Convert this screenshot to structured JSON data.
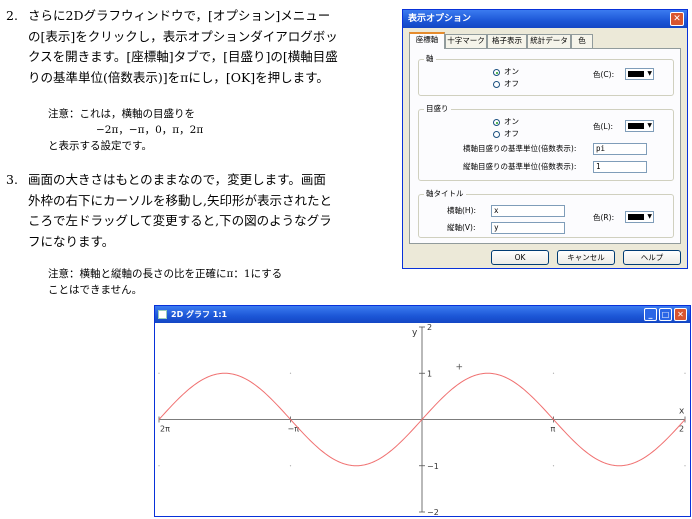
{
  "doc": {
    "item2": {
      "num": "2.",
      "lines": [
        "さらに2Dグラフウィンドウで，[オプション]メニュー",
        "の[表示]をクリックし，表示オプションダイアログボッ",
        "クスを開きます。[座標軸]タブで，[目盛り]の[横軸目盛",
        "りの基準単位(倍数表示)]をπにし，[OK]を押します。"
      ],
      "note": [
        "注意：これは，横軸の目盛りを",
        "−2π，−π，0，π，2π",
        "と表示する設定です。"
      ]
    },
    "item3": {
      "num": "3.",
      "lines": [
        "画面の大きさはもとのままなので，変更します。画面",
        "外枠の右下にカーソルを移動し,矢印形が表示されたと",
        "ころで左ドラッグして変更すると,下の図のようなグラ",
        "フになります。"
      ],
      "note": [
        "注意：横軸と縦軸の長さの比を正確にπ：1にする",
        "ことはできません。"
      ]
    }
  },
  "dialog": {
    "title": "表示オプション",
    "close": "✕",
    "tabs": [
      "座標軸",
      "十字マーク",
      "格子表示",
      "統計データ",
      "色"
    ],
    "axis_group": {
      "title": "軸",
      "on": "オン",
      "off": "オフ",
      "color_label": "色(C):"
    },
    "tick_group": {
      "title": "目盛り",
      "on": "オン",
      "off": "オフ",
      "color_label": "色(L):",
      "x_unit_label": "横軸目盛りの基準単位(倍数表示):",
      "x_unit_value": "pi",
      "y_unit_label": "縦軸目盛りの基準単位(倍数表示):",
      "y_unit_value": "1"
    },
    "title_group": {
      "title": "軸タイトル",
      "x_label": "横軸(H):",
      "x_value": "x",
      "y_label": "縦軸(V):",
      "y_value": "y",
      "color_label": "色(R):"
    },
    "buttons": {
      "ok": "OK",
      "cancel": "キャンセル",
      "help": "ヘルプ"
    }
  },
  "graph_window": {
    "title": "2D グラフ 1:1",
    "min": "_",
    "max": "□",
    "close": "✕"
  },
  "chart_data": {
    "type": "line",
    "function": "sin(x)",
    "x_range": [
      -6.2832,
      6.2832
    ],
    "y_range": [
      -2,
      2
    ],
    "x_ticks": [
      {
        "value": -6.2832,
        "label": "2π"
      },
      {
        "value": -3.1416,
        "label": "−π"
      },
      {
        "value": 3.1416,
        "label": "π"
      },
      {
        "value": 6.2832,
        "label": "2"
      }
    ],
    "y_ticks": [
      {
        "value": 2,
        "label": "2"
      },
      {
        "value": 1,
        "label": "1"
      },
      {
        "value": -1,
        "label": "−1"
      },
      {
        "value": -2,
        "label": "−2"
      }
    ],
    "xlabel": "x",
    "ylabel": "y",
    "colors": {
      "curve": "#f07070",
      "axis": "#505050",
      "tick": "#555555"
    }
  }
}
